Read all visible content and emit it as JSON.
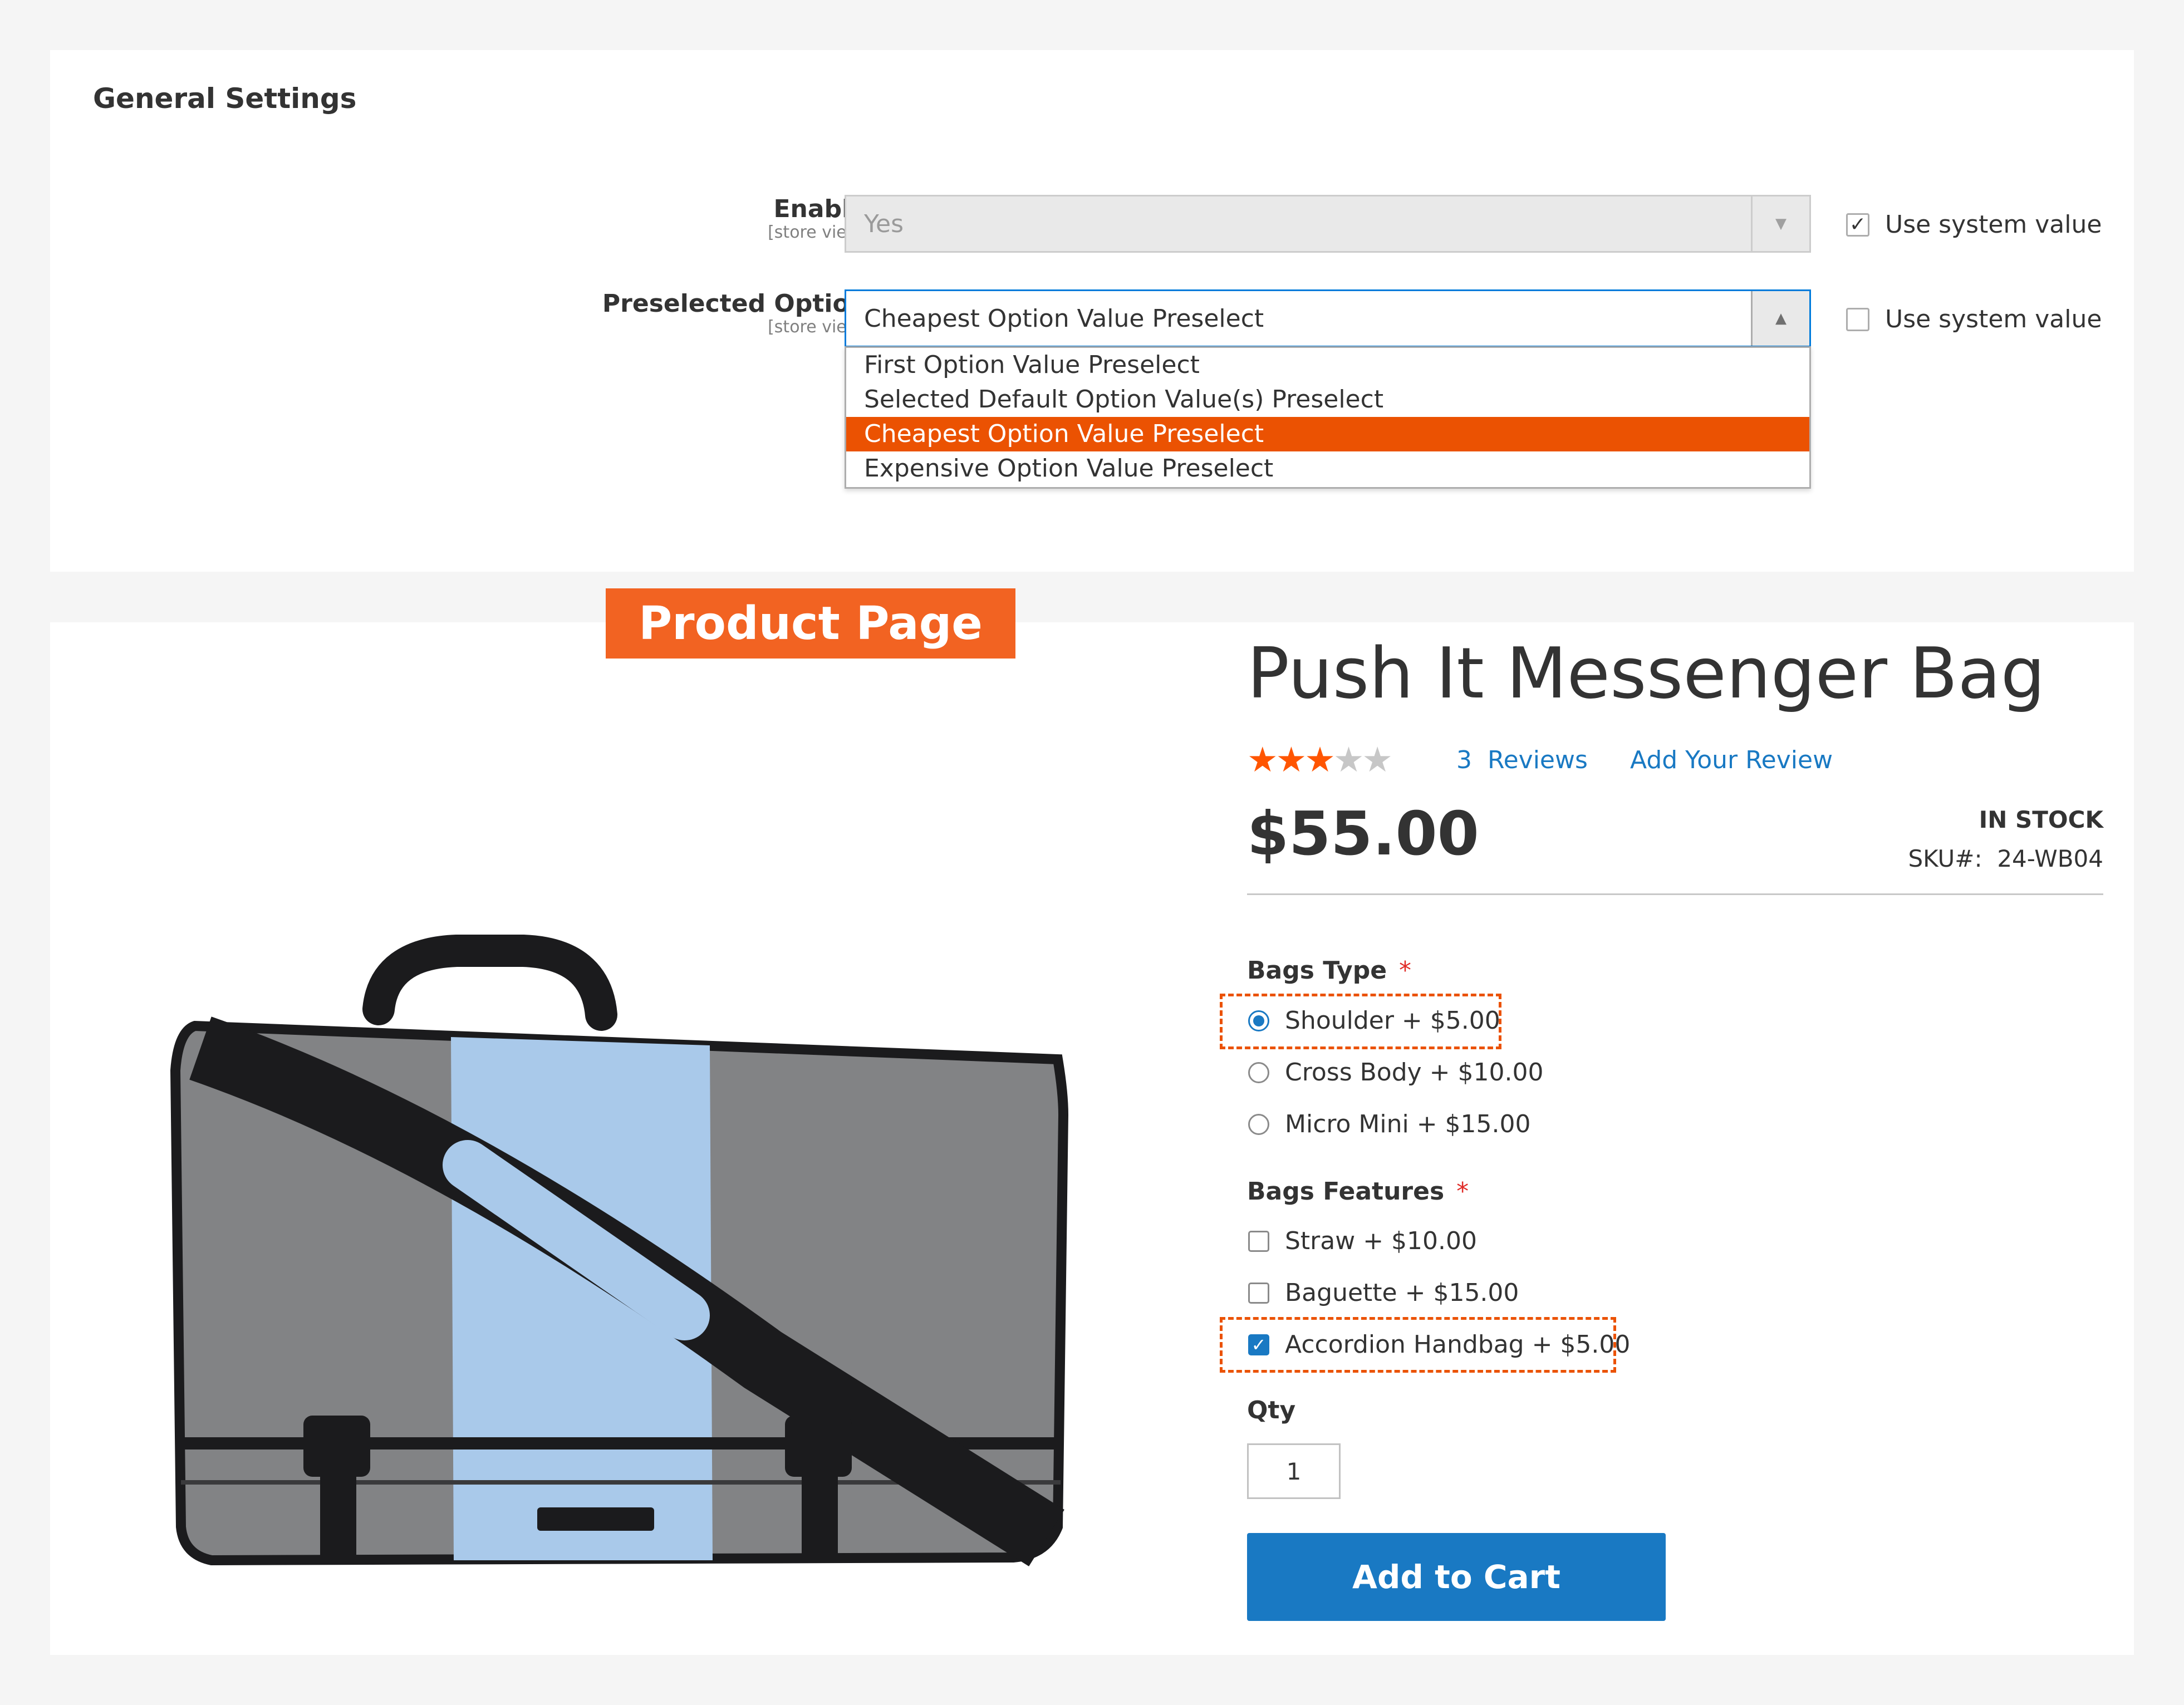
{
  "settings": {
    "section_title": "General Settings",
    "enable": {
      "label": "Enable",
      "scope": "[store view]",
      "value": "Yes",
      "use_system_value_label": "Use system value",
      "use_system_value_checked": true
    },
    "preselected": {
      "label": "Preselected Option",
      "scope": "[store view]",
      "value": "Cheapest Option Value Preselect",
      "use_system_value_label": "Use system value",
      "use_system_value_checked": false,
      "options": [
        "First Option Value Preselect",
        "Selected Default Option Value(s) Preselect",
        "Cheapest Option Value Preselect",
        "Expensive Option Value Preselect"
      ],
      "selected_index": 2
    }
  },
  "banner": {
    "label": "Product Page"
  },
  "product": {
    "title": "Push It Messenger Bag",
    "rating": {
      "value": 2.5,
      "max": 5
    },
    "reviews_count": "3",
    "reviews_label": "Reviews",
    "add_review_label": "Add Your Review",
    "price": "$55.00",
    "stock_status": "IN STOCK",
    "sku_label": "SKU#:",
    "sku": "24-WB04",
    "bags_type": {
      "label": "Bags Type",
      "required_mark": "*",
      "options": [
        "Shoulder + $5.00",
        "Cross Body + $10.00",
        "Micro Mini + $15.00"
      ],
      "selected_index": 0
    },
    "bags_features": {
      "label": "Bags Features",
      "required_mark": "*",
      "options": [
        "Straw + $10.00",
        "Baguette + $15.00",
        "Accordion Handbag + $5.00"
      ],
      "checked": [
        false,
        false,
        true
      ]
    },
    "qty_label": "Qty",
    "qty_value": "1",
    "add_to_cart_label": "Add to Cart"
  },
  "colors": {
    "accent_orange": "#eb5202",
    "banner_orange": "#f26322",
    "link_blue": "#1979c3",
    "bag_grey": "#828385",
    "bag_light_blue": "#a9c9ea",
    "strap_black": "#1b1b1d"
  }
}
